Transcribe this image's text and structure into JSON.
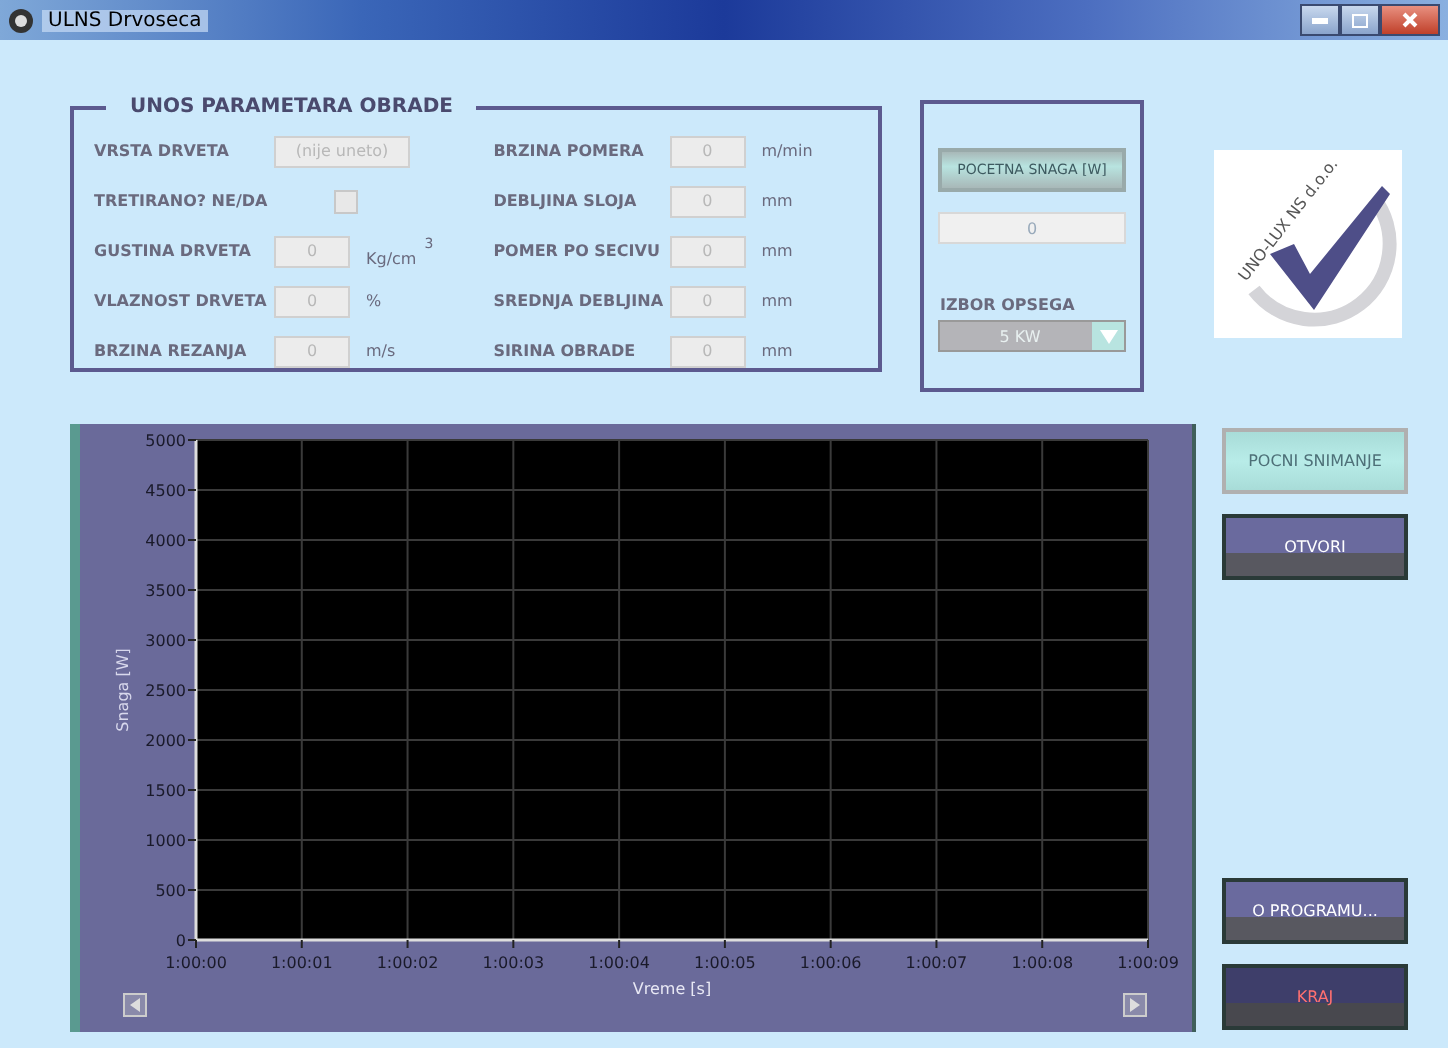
{
  "window": {
    "title": "ULNS Drvoseca"
  },
  "parameters": {
    "title": "UNOS PARAMETARA OBRADE",
    "left": [
      {
        "kind": "text",
        "label": "VRSTA DRVETA",
        "placeholder": "(nije uneto)",
        "disabled": true
      },
      {
        "kind": "checkbox",
        "label": "TRETIRANO? NE/DA",
        "checked": false,
        "disabled": true
      },
      {
        "kind": "number",
        "label": "GUSTINA DRVETA",
        "value": "0",
        "unit": "Kg/cm$^{3}$",
        "disabled": true
      },
      {
        "kind": "number",
        "label": "VLAZNOST DRVETA",
        "value": "0",
        "unit": "%",
        "disabled": true
      },
      {
        "kind": "number",
        "label": "BRZINA REZANJA",
        "value": "0",
        "unit": "m/s",
        "disabled": true
      }
    ],
    "right": [
      {
        "kind": "number",
        "label": "BRZINA POMERA",
        "value": "0",
        "unit": "m/min",
        "disabled": true
      },
      {
        "kind": "number",
        "label": "DEBLJINA SLOJA",
        "value": "0",
        "unit": "mm",
        "disabled": true
      },
      {
        "kind": "number",
        "label": "POMER PO SECIVU",
        "value": "0",
        "unit": "mm",
        "disabled": true
      },
      {
        "kind": "number",
        "label": "SREDNJA DEBLJINA",
        "value": "0",
        "unit": "mm",
        "disabled": true
      },
      {
        "kind": "number",
        "label": "SIRINA OBRADE",
        "value": "0",
        "unit": "mm",
        "disabled": true
      }
    ]
  },
  "power": {
    "button": {
      "label": "POCETNA SNAGA [W]",
      "disabled": true
    },
    "display": "0",
    "range_label": "IZBOR OPSEGA",
    "range": {
      "value": "5 KW",
      "disabled": true
    }
  },
  "logo": {
    "text": "UNO-LUX NS d.o.o."
  },
  "chart": {
    "chart_data": {
      "type": "line",
      "xlabel": "Vreme [s]",
      "ylabel": "Snaga [W]",
      "ylim": [
        0,
        5000
      ],
      "grid": true,
      "yticks": [
        0,
        500,
        1000,
        1500,
        2000,
        2500,
        3000,
        3500,
        4000,
        4500,
        5000
      ],
      "categories": [
        "1:00:00",
        "1:00:01",
        "1:00:02",
        "1:00:03",
        "1:00:04",
        "1:00:05",
        "1:00:06",
        "1:00:07",
        "1:00:08",
        "1:00:09"
      ]
    }
  },
  "buttons": [
    {
      "label": "POCNI SNIMANJE",
      "kind": "normal",
      "disabled": true
    },
    {
      "label": "OTVORI",
      "kind": "normal",
      "disabled": false
    },
    {
      "kind": "spacer"
    },
    {
      "label": "O PROGRAMU...",
      "kind": "normal",
      "disabled": false
    },
    {
      "label": "KRAJ",
      "kind": "danger",
      "disabled": false
    }
  ]
}
